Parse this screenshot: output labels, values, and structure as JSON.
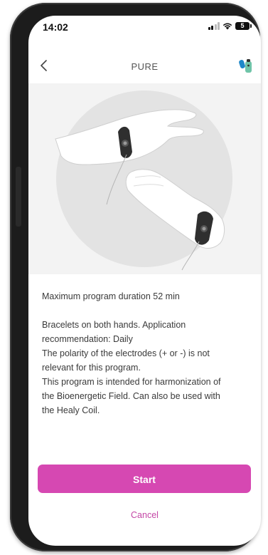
{
  "status_bar": {
    "time": "14:02",
    "battery_level": "5"
  },
  "nav": {
    "title": "PURE",
    "back_icon": "chevron-left-icon",
    "device_icon": "healy-device-icon"
  },
  "illustration": {
    "icon": "hands-with-bracelets-illustration"
  },
  "program": {
    "duration": "Maximum program duration 52 min",
    "description_lines": [
      "Bracelets on both hands. Application",
      "recommendation: Daily",
      "The polarity of the electrodes (+ or -) is not",
      "relevant for this program.",
      "This program is intended for harmonization of",
      "the Bioenergetic Field. Can also be used with",
      "the Healy Coil."
    ]
  },
  "actions": {
    "start_label": "Start",
    "cancel_label": "Cancel"
  },
  "colors": {
    "accent": "#d648b2",
    "cancel_text": "#c447a6",
    "illustration_bg": "#f3f3f3",
    "circle_bg": "#e3e3e3"
  }
}
